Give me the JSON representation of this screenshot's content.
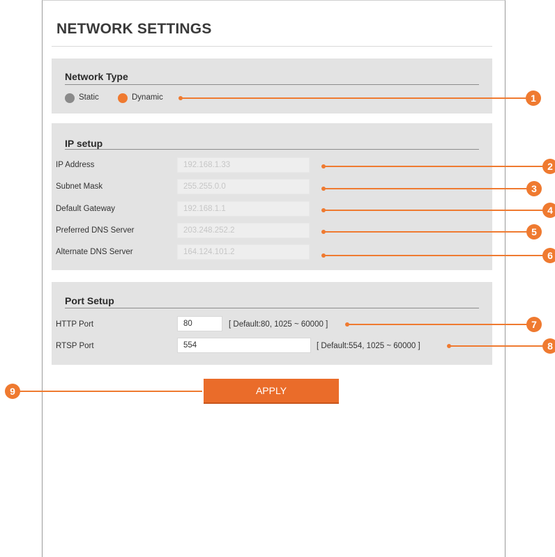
{
  "page": {
    "title": "NETWORK SETTINGS"
  },
  "network_type": {
    "title": "Network Type",
    "options": [
      {
        "label": "Static",
        "selected": false,
        "color": "#8a8a8a"
      },
      {
        "label": "Dynamic",
        "selected": true,
        "color": "#ef7a30"
      }
    ]
  },
  "ip_setup": {
    "title": "IP setup",
    "rows": [
      {
        "label": "IP Address",
        "value": "192.168.1.33"
      },
      {
        "label": "Subnet Mask",
        "value": "255.255.0.0"
      },
      {
        "label": "Default Gateway",
        "value": "192.168.1.1"
      },
      {
        "label": "Preferred DNS Server",
        "value": "203.248.252.2"
      },
      {
        "label": "Alternate DNS Server",
        "value": "164.124.101.2"
      }
    ]
  },
  "port_setup": {
    "title": "Port Setup",
    "rows": [
      {
        "label": "HTTP Port",
        "value": "80",
        "hint": "[ Default:80, 1025 ~ 60000 ]"
      },
      {
        "label": "RTSP Port",
        "value": "554",
        "hint": "[ Default:554, 1025 ~ 60000 ]"
      }
    ]
  },
  "apply_label": "APPLY",
  "callouts": [
    "1",
    "2",
    "3",
    "4",
    "5",
    "6",
    "7",
    "8",
    "9"
  ],
  "colors": {
    "accent": "#ef7a30",
    "panel": "#e3e3e3",
    "button": "#ea6c2a"
  }
}
